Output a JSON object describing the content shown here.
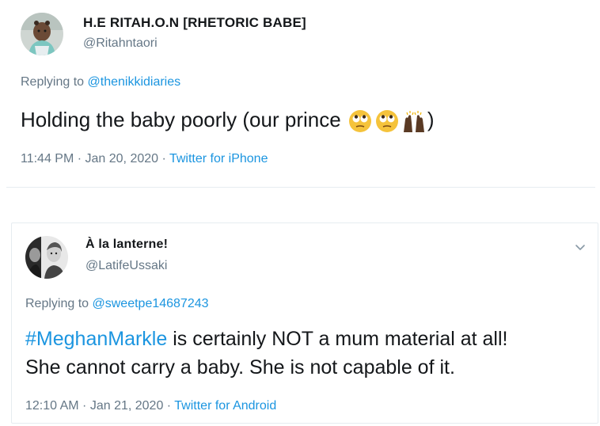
{
  "tweets": [
    {
      "name": "H.E RITAH.O.N [RHETORIC BABE]",
      "handle": "@Ritahntaori",
      "replying_prefix": "Replying to ",
      "replying_to": "@thenikkidiaries",
      "text_before": "Holding the baby poorly (our prince",
      "emojis": [
        "eye-roll-face-icon",
        "eye-roll-face-icon",
        "raising-hands-icon"
      ],
      "text_after": ")",
      "time": "11:44 PM · Jan 20, 2020 · ",
      "source": "Twitter for iPhone",
      "avatar": "baby-photo-avatar"
    },
    {
      "name": "À la lanterne!",
      "handle": "@LatifeUssaki",
      "replying_prefix": "Replying to ",
      "replying_to": "@sweetpe14687243",
      "hashtag": "#MeghanMarkle",
      "text_line1_rest": " is certainly NOT a mum material at all!",
      "text_line2": "She cannot carry a baby. She is not capable of it.",
      "time": "12:10 AM · Jan 21, 2020 · ",
      "source": "Twitter for Android",
      "avatar": "bw-portrait-avatar",
      "menu_icon": "chevron-down-icon"
    }
  ],
  "colors": {
    "link": "#1b95e0",
    "secondary": "#657786",
    "text": "#14171a",
    "border": "#e6ecf0"
  }
}
